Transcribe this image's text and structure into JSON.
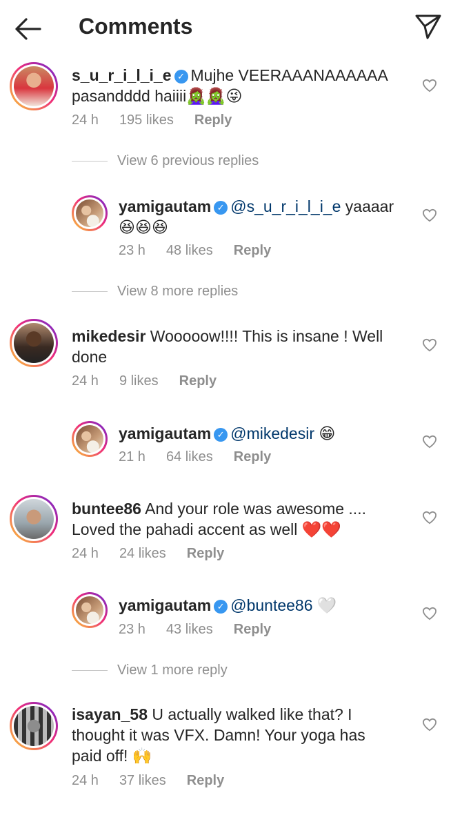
{
  "header": {
    "title": "Comments",
    "back_icon": "arrow-left-icon",
    "send_icon": "paper-plane-icon"
  },
  "comments": [
    {
      "username": "s_u_r_i_l_i_e",
      "verified": true,
      "line1": "Mujhe VEERAAANAAAAAA",
      "line2": "pasandddd haiiii🧟‍♀️🧟‍♀️😜",
      "time": "24 h",
      "likes": "195 likes",
      "reply": "Reply"
    },
    {
      "view_replies": "View 6 previous replies"
    },
    {
      "username": "yamigautam",
      "verified": true,
      "mention": "@s_u_r_i_l_i_e",
      "line1_rest": " yaaaar",
      "line2": "😆😆😆",
      "time": "23 h",
      "likes": "48 likes",
      "reply": "Reply"
    },
    {
      "view_replies": "View 8 more replies"
    },
    {
      "username": "mikedesir",
      "line1": " Wooooow!!!! This is insane ! Well",
      "line2": "done",
      "time": "24 h",
      "likes": "9 likes",
      "reply": "Reply"
    },
    {
      "username": "yamigautam",
      "verified": true,
      "mention": "@mikedesir",
      "emoji": " 😁",
      "time": "21 h",
      "likes": "64 likes",
      "reply": "Reply"
    },
    {
      "username": "buntee86",
      "line1": " And your role was awesome ....",
      "line2": "Loved the pahadi accent as well ❤️❤️",
      "time": "24 h",
      "likes": "24 likes",
      "reply": "Reply"
    },
    {
      "username": "yamigautam",
      "verified": true,
      "mention": "@buntee86",
      "emoji": " 🤍",
      "time": "23 h",
      "likes": "43 likes",
      "reply": "Reply"
    },
    {
      "view_replies": "View 1 more reply"
    },
    {
      "username": "isayan_58",
      "line1": " U actually walked like that? I",
      "line2": "thought it was VFX. Damn! Your yoga has",
      "line3": "paid off! 🙌",
      "time": "24 h",
      "likes": "37 likes",
      "reply": "Reply"
    }
  ],
  "colors": {
    "text": "#262626",
    "meta": "#8e8e8e",
    "verified": "#3897f0",
    "mention": "#00376b"
  }
}
